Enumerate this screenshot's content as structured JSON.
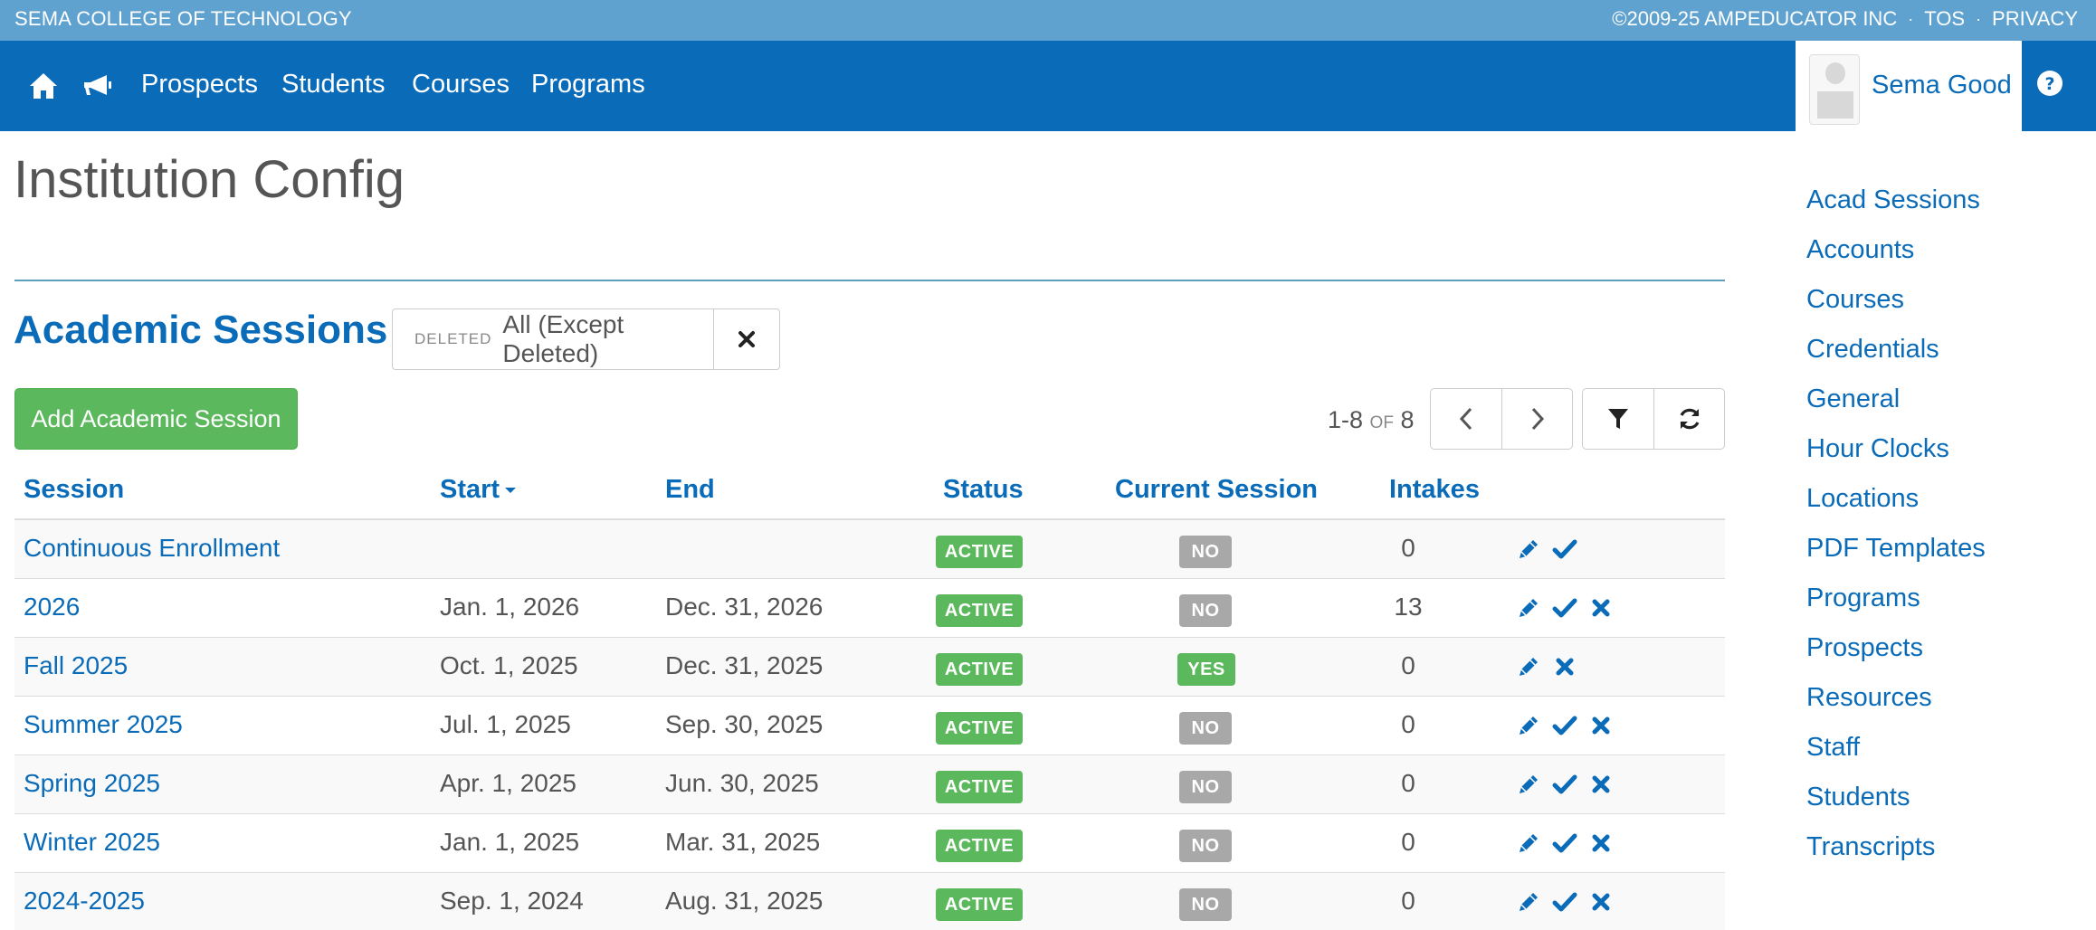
{
  "topbar": {
    "institution": "SEMA COLLEGE OF TECHNOLOGY",
    "copyright": "©2009-25 AMPEDUCATOR INC",
    "tos": "TOS",
    "privacy": "PRIVACY",
    "separator": "·"
  },
  "nav": {
    "home_icon": "home-icon",
    "announce_icon": "bullhorn-icon",
    "links": [
      "Prospects",
      "Students",
      "Courses",
      "Programs"
    ],
    "user_name": "Sema Good",
    "help_icon": "question-circle-icon"
  },
  "page": {
    "title": "Institution Config",
    "section_title": "Academic Sessions",
    "filter_label": "DELETED",
    "filter_value": "All (Except Deleted)",
    "add_button": "Add Academic Session",
    "pager_range": "1-8",
    "pager_of": "OF",
    "pager_total": "8"
  },
  "table": {
    "headers": {
      "session": "Session",
      "start": "Start",
      "end": "End",
      "status": "Status",
      "current": "Current Session",
      "intakes": "Intakes"
    },
    "rows": [
      {
        "session": "Continuous Enrollment",
        "start": "",
        "end": "",
        "status": "ACTIVE",
        "current": "NO",
        "intakes": "0",
        "actions": [
          "edit",
          "check"
        ]
      },
      {
        "session": "2026",
        "start": "Jan. 1, 2026",
        "end": "Dec. 31, 2026",
        "status": "ACTIVE",
        "current": "NO",
        "intakes": "13",
        "actions": [
          "edit",
          "check",
          "delete"
        ]
      },
      {
        "session": "Fall 2025",
        "start": "Oct. 1, 2025",
        "end": "Dec. 31, 2025",
        "status": "ACTIVE",
        "current": "YES",
        "intakes": "0",
        "actions": [
          "edit",
          "delete"
        ]
      },
      {
        "session": "Summer 2025",
        "start": "Jul. 1, 2025",
        "end": "Sep. 30, 2025",
        "status": "ACTIVE",
        "current": "NO",
        "intakes": "0",
        "actions": [
          "edit",
          "check",
          "delete"
        ]
      },
      {
        "session": "Spring 2025",
        "start": "Apr. 1, 2025",
        "end": "Jun. 30, 2025",
        "status": "ACTIVE",
        "current": "NO",
        "intakes": "0",
        "actions": [
          "edit",
          "check",
          "delete"
        ]
      },
      {
        "session": "Winter 2025",
        "start": "Jan. 1, 2025",
        "end": "Mar. 31, 2025",
        "status": "ACTIVE",
        "current": "NO",
        "intakes": "0",
        "actions": [
          "edit",
          "check",
          "delete"
        ]
      },
      {
        "session": "2024-2025",
        "start": "Sep. 1, 2024",
        "end": "Aug. 31, 2025",
        "status": "ACTIVE",
        "current": "NO",
        "intakes": "0",
        "actions": [
          "edit",
          "check",
          "delete"
        ]
      }
    ]
  },
  "sidebar": {
    "items": [
      "Acad Sessions",
      "Accounts",
      "Courses",
      "Credentials",
      "General",
      "Hour Clocks",
      "Locations",
      "PDF Templates",
      "Programs",
      "Prospects",
      "Resources",
      "Staff",
      "Students",
      "Transcripts"
    ]
  },
  "colors": {
    "nav_blue": "#0a6bb8",
    "top_strip": "#5fa2d0",
    "success_green": "#5cb85c",
    "muted_gray": "#a8a8a8"
  }
}
